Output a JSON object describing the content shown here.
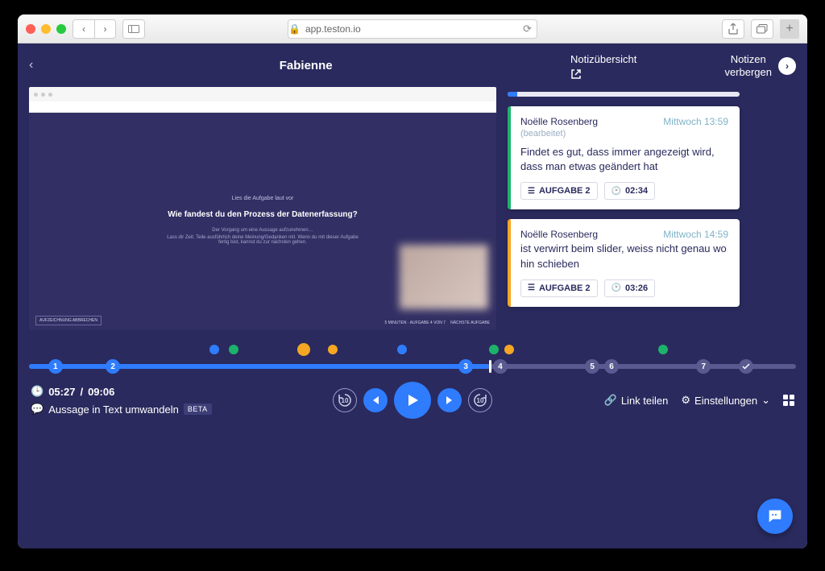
{
  "browser": {
    "url_label": "app.teston.io",
    "lock_icon": "🔒"
  },
  "header": {
    "title": "Fabienne",
    "notes_overview": "Notizübersicht",
    "hide_notes_line1": "Notizen",
    "hide_notes_line2": "verbergen"
  },
  "video": {
    "pre_text": "Lies die Aufgabe laut vor",
    "question": "Wie fandest du den Prozess der Datenerfassung?",
    "hint1": "Der Vorgang um eine Aussage aufzunehmen…",
    "hint2": "Lass dir Zeit. Teile ausführlich deine Meinung/Gedanken mit. Wenn du mit dieser Aufgabe fertig bist, kannst du zur nächsten gehen.",
    "stop_label": "AUFZEICHNUNG ABBRECHEN",
    "task_meta": "5 MINUTEN · AUFGABE 4 VON 7",
    "next_label": "NÄCHSTE AUFGABE"
  },
  "notes": [
    {
      "color": "green",
      "author": "Noëlle Rosenberg",
      "time": "Mittwoch 13:59",
      "edited": "(bearbeitet)",
      "body": "Findet es gut, dass immer angezeigt wird, dass man etwas geändert hat",
      "task_tag": "AUFGABE 2",
      "time_tag": "02:34"
    },
    {
      "color": "orange",
      "author": "Noëlle Rosenberg",
      "time": "Mittwoch 14:59",
      "edited": "",
      "body": "ist verwirrt beim slider, weiss nicht genau wo hin schieben",
      "task_tag": "AUFGABE 2",
      "time_tag": "03:26"
    }
  ],
  "timeline": {
    "progress_pct": 60,
    "markers": [
      {
        "pct": 23.5,
        "color": "blue"
      },
      {
        "pct": 26,
        "color": "green"
      },
      {
        "pct": 35,
        "color": "orange",
        "big": true
      },
      {
        "pct": 39,
        "color": "orange"
      },
      {
        "pct": 48,
        "color": "blue"
      },
      {
        "pct": 60,
        "color": "green"
      },
      {
        "pct": 62,
        "color": "orange"
      },
      {
        "pct": 82,
        "color": "green"
      }
    ],
    "steps": [
      {
        "label": "1",
        "pct": 2.5,
        "done": true
      },
      {
        "label": "2",
        "pct": 10,
        "done": true
      },
      {
        "label": "3",
        "pct": 56,
        "done": true
      },
      {
        "label": "4",
        "pct": 60.5,
        "done": false
      },
      {
        "label": "5",
        "pct": 72.5,
        "done": false
      },
      {
        "label": "6",
        "pct": 75,
        "done": false
      },
      {
        "label": "7",
        "pct": 87,
        "done": false
      },
      {
        "label": "✓",
        "pct": 92.5,
        "done": false,
        "check": true
      }
    ]
  },
  "footer": {
    "current_time": "05:27",
    "total_time": "09:06",
    "transcribe": "Aussage in Text umwandeln",
    "beta": "BETA",
    "share": "Link teilen",
    "settings": "Einstellungen"
  }
}
